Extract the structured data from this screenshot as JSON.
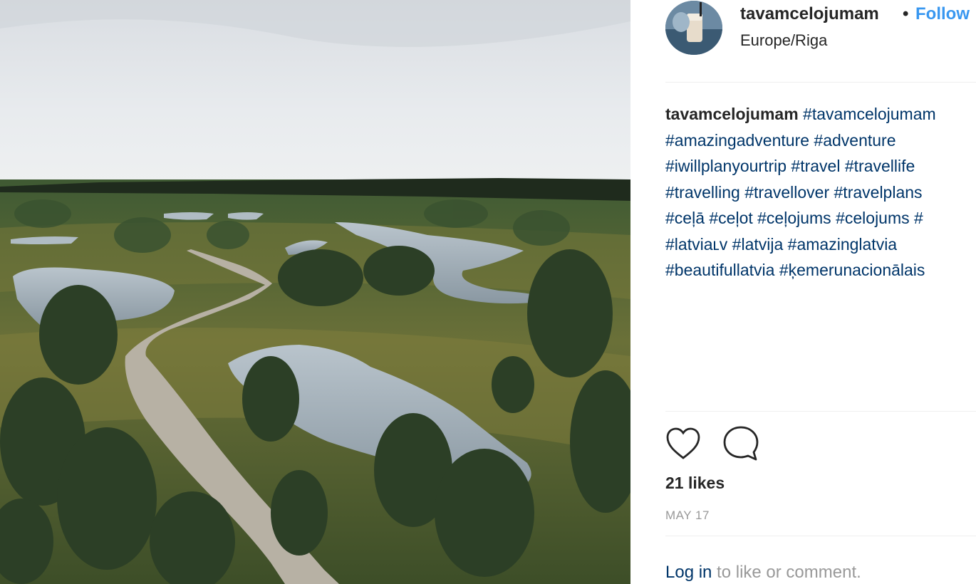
{
  "post": {
    "username": "tavamcelojumam",
    "separator": "•",
    "follow_label": "Follow",
    "location": "Europe/Riga",
    "caption": {
      "username": "tavamcelojumam",
      "lines": [
        [
          "#tavamcelojumam"
        ],
        [
          "#amazingadventure",
          "#adventure"
        ],
        [
          "#iwillplanyourtrip",
          "#travel",
          "#travellife"
        ],
        [
          "#travelling",
          "#travellover",
          "#travelplans"
        ],
        [
          "#ceļā",
          "#ceļot",
          "#ceļojums",
          "#celojums",
          "#"
        ],
        [
          "#latviaʟv",
          "#latvija",
          "#amazinglatvia"
        ],
        [
          "#beautifullatvia",
          "#ķemerunacionālais"
        ]
      ]
    },
    "likes": "21 likes",
    "date": "MAY 17",
    "login_link": "Log in",
    "login_rest": " to like or comment.",
    "icons": {
      "like": "heart-icon",
      "comment": "comment-icon"
    }
  },
  "colors": {
    "link": "#003569",
    "follow": "#3897f0",
    "muted": "#999999"
  }
}
